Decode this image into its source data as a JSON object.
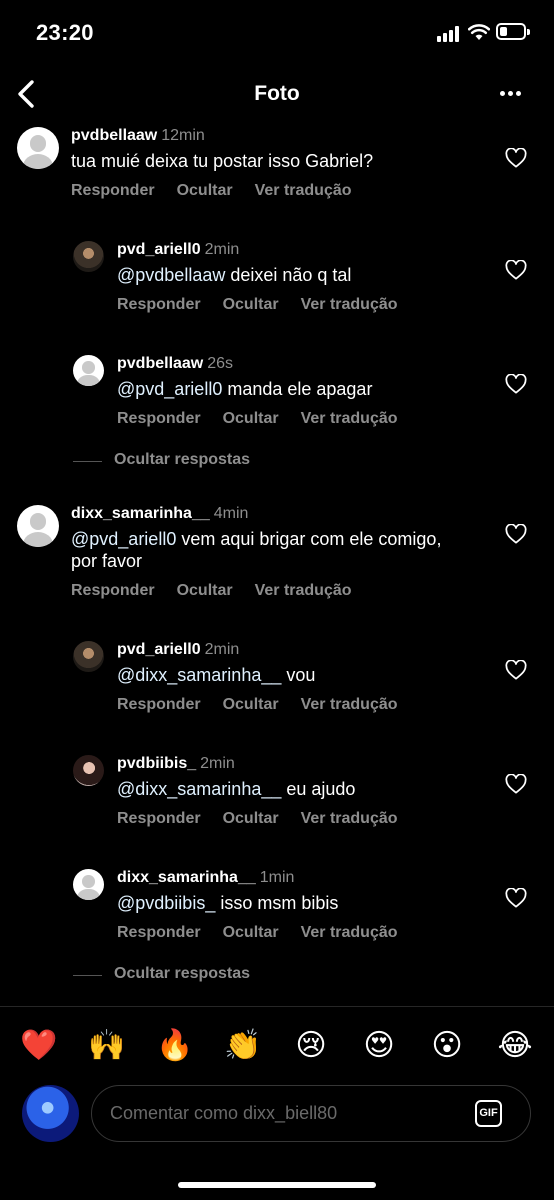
{
  "status_bar": {
    "time": "23:20"
  },
  "header": {
    "title": "Foto",
    "back_icon": "chevron-left-icon",
    "more_icon": "ellipsis-icon"
  },
  "actions": {
    "reply": "Responder",
    "hide": "Ocultar",
    "translate": "Ver tradução"
  },
  "comments": [
    {
      "user": "pvdbellaaw",
      "time": "12min",
      "text_mention": "",
      "text": "tua muié deixa tu postar isso Gabriel?",
      "replies": [
        {
          "user": "pvd_ariell0",
          "time": "2min",
          "text_mention": "@pvdbellaaw",
          "text": " deixei não q tal"
        },
        {
          "user": "pvdbellaaw",
          "time": "26s",
          "text_mention": "@pvd_ariell0",
          "text": " manda ele apagar"
        }
      ],
      "hide_replies_label": "Ocultar respostas"
    },
    {
      "user": "dixx_samarinha__",
      "time": "4min",
      "text_mention": "@pvd_ariell0",
      "text": " vem aqui brigar com ele comigo, por favor",
      "replies": [
        {
          "user": "pvd_ariell0",
          "time": "2min",
          "text_mention": "@dixx_samarinha__",
          "text": " vou"
        },
        {
          "user": "pvdbiibis_",
          "time": "2min",
          "text_mention": "@dixx_samarinha__",
          "text": " eu ajudo"
        },
        {
          "user": "dixx_samarinha__",
          "time": "1min",
          "text_mention": "@pvdbiibis_",
          "text": " isso msm bibis"
        }
      ],
      "hide_replies_label": "Ocultar respostas"
    }
  ],
  "emoji_bar": [
    "❤️",
    "🙌",
    "🔥",
    "👏",
    "😢",
    "😍",
    "😮",
    "😂"
  ],
  "composer": {
    "placeholder": "Comentar como dixx_biell80",
    "gif_label": "GIF"
  }
}
